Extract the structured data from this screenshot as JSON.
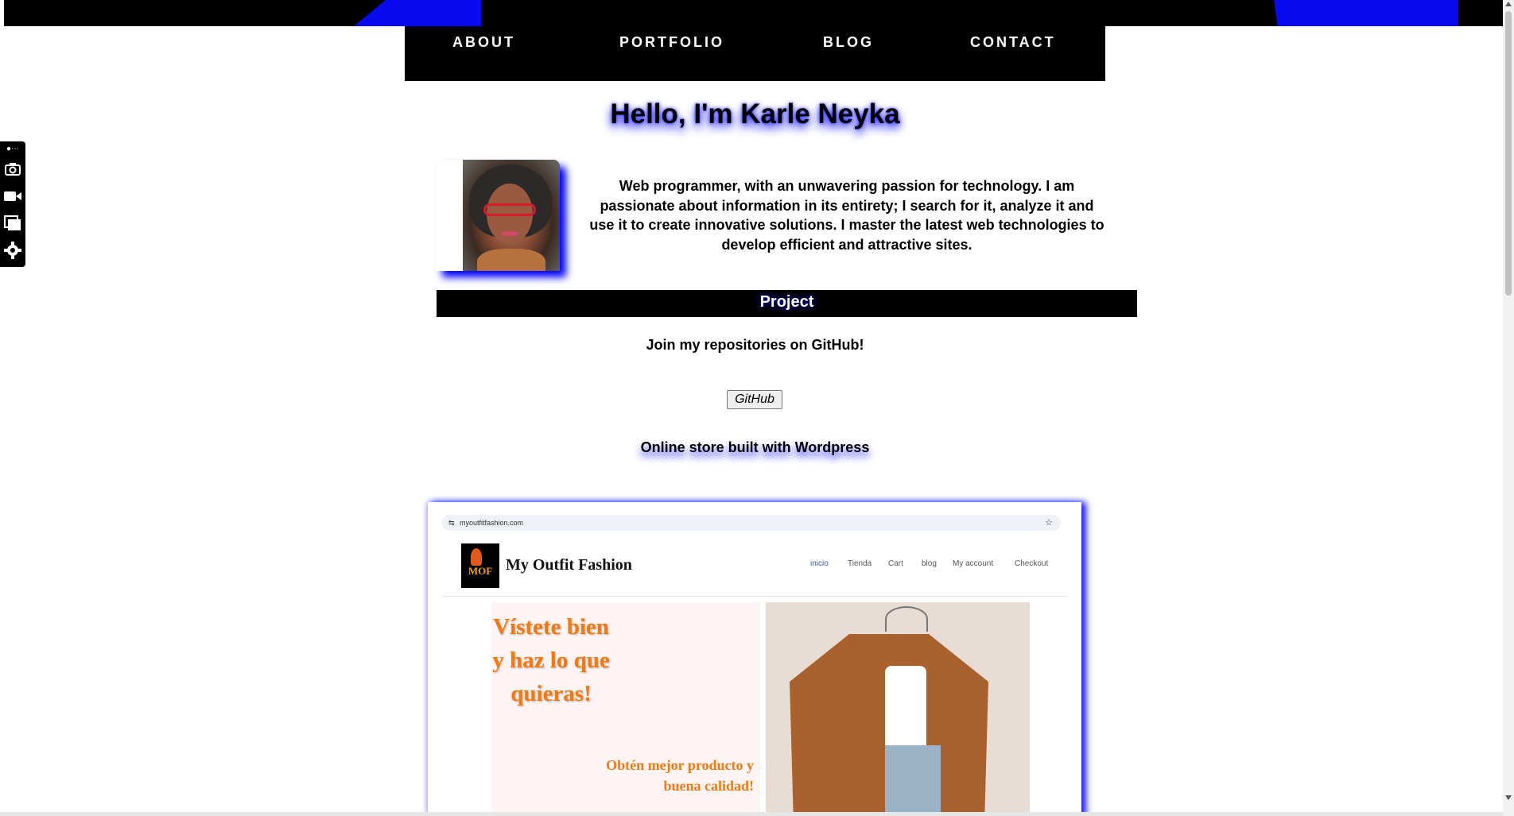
{
  "nav": {
    "items": [
      "ABOUT",
      "PORTFOLIO",
      "BLOG",
      "CONTACT"
    ]
  },
  "toolbar": {
    "icons": [
      "pin-icon",
      "camera-icon",
      "video-icon",
      "window-icon",
      "gear-icon"
    ]
  },
  "hero": {
    "title": "Hello, I'm Karle Neyka",
    "intro": "Web programmer, with an unwavering passion for technology. I am passionate about information in its entirety; I search for it, analyze it and use it to create innovative solutions. I master the latest web technologies to develop efficient and attractive sites."
  },
  "project": {
    "heading": "Project",
    "github_text": "Join my repositories on GitHub!",
    "github_button": "GitHub",
    "store_text": "Online store built with Wordpress"
  },
  "screenshot": {
    "url": "myoutfitfashion.com",
    "logo": "MOF",
    "brand": "My Outfit Fashion",
    "menu": [
      "inicio",
      "Tienda",
      "Cart",
      "blog",
      "My account",
      "Checkout"
    ],
    "hero_title": "Vístete bien y haz lo que quieras!",
    "hero_sub": "Obtén mejor producto y buena calidad!"
  },
  "colors": {
    "accent": "#0000ff",
    "nav_bg": "#000000",
    "store_orange": "#f07a10"
  }
}
